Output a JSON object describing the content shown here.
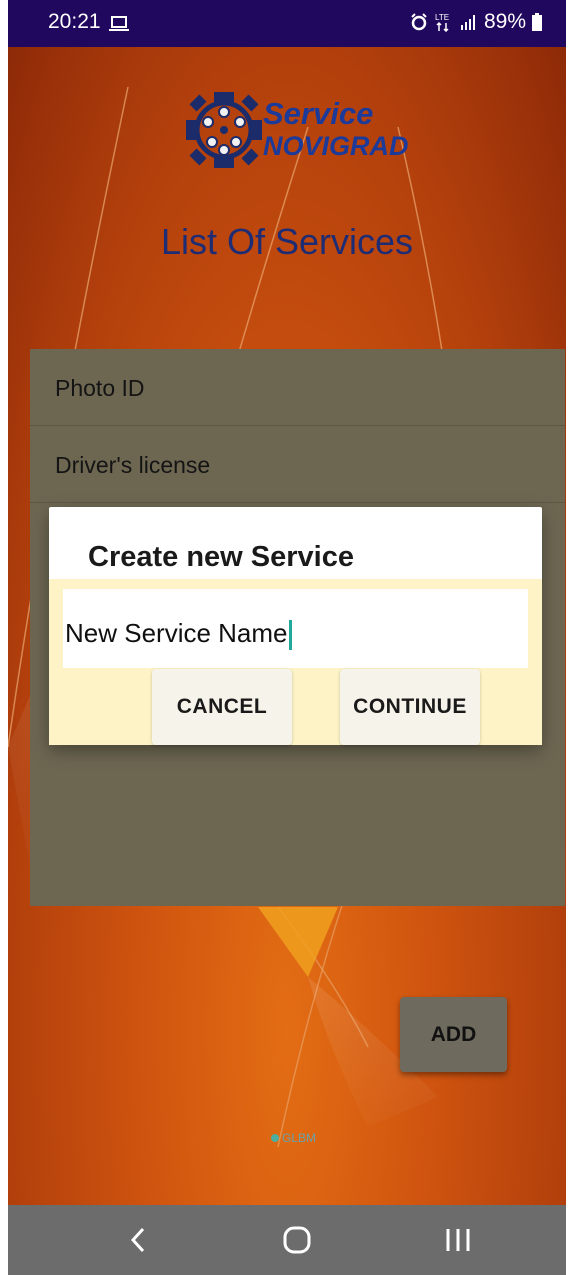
{
  "status_bar": {
    "time": "20:21",
    "network": "LTE",
    "battery": "89%",
    "icons": [
      "laptop-icon",
      "alarm-icon",
      "lte-icon",
      "signal-icon",
      "battery-icon"
    ]
  },
  "app": {
    "logo_line1": "Service",
    "logo_line2": "NOVIGRAD",
    "page_title": "List Of Services",
    "list_items": [
      "Photo ID",
      "Driver's license"
    ],
    "add_button_label": "ADD",
    "watermark": "GLBM"
  },
  "dialog": {
    "title": "Create new Service",
    "input_value": "New Service Name",
    "cancel_label": "CANCEL",
    "continue_label": "CONTINUE"
  },
  "nav_bar": {
    "icons": [
      "back-icon",
      "home-icon",
      "recents-icon"
    ]
  },
  "colors": {
    "status_bar": "#20085e",
    "background_orange": "#d0550f",
    "list_panel": "#6d6752",
    "dialog_body": "#fdf3c6",
    "logo_blue": "#1c3a99",
    "title_blue": "#1e2c74",
    "caret_teal": "#22a99e",
    "nav_bar": "#6c6c6c"
  }
}
